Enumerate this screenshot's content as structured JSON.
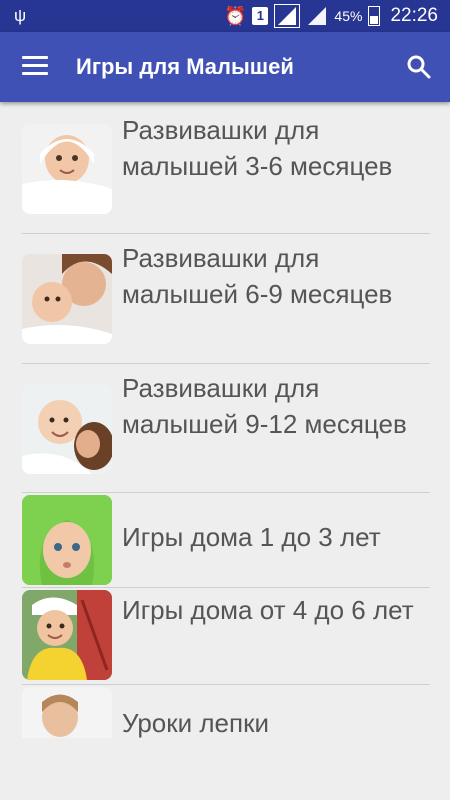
{
  "status_bar": {
    "sim_slot": "1",
    "battery_percent": "45%",
    "time": "22:26"
  },
  "app_bar": {
    "title": "Игры для Малышей"
  },
  "items": [
    {
      "label": "Развивашки для малышей 3-6 месяцев"
    },
    {
      "label": "Развивашки для малышей 6-9 месяцев"
    },
    {
      "label": "Развивашки для малышей 9-12 месяцев"
    },
    {
      "label": "Игры дома  1 до 3 лет"
    },
    {
      "label": "Игры дома от 4 до 6 лет"
    },
    {
      "label": "Уроки лепки"
    }
  ],
  "colors": {
    "status_bar": "#273593",
    "app_bar": "#3f51b5",
    "background": "#eeeeee",
    "item_text": "#555555"
  }
}
